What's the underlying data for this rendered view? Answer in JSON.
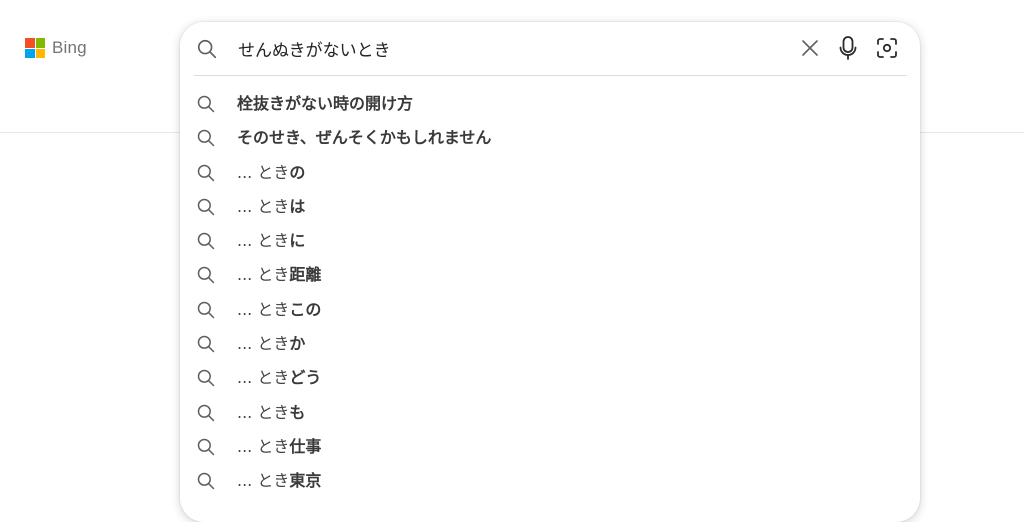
{
  "brand": {
    "name": "Bing",
    "logo_colors": [
      "#f25022",
      "#7fba00",
      "#00a4ef",
      "#ffb900"
    ]
  },
  "search": {
    "query": "せんぬきがないとき",
    "icons": {
      "search": "search-icon",
      "clear": "close-icon",
      "voice": "microphone-icon",
      "visual": "visual-search-icon"
    }
  },
  "suggestions": [
    {
      "prefix": "",
      "completion": "栓抜きがない時の開け方"
    },
    {
      "prefix": "",
      "completion": "そのせき、ぜんそくかもしれません"
    },
    {
      "prefix": "... とき",
      "completion": "の"
    },
    {
      "prefix": "... とき",
      "completion": "は"
    },
    {
      "prefix": "... とき",
      "completion": "に"
    },
    {
      "prefix": "... とき",
      "completion": "距離"
    },
    {
      "prefix": "... とき",
      "completion": "この"
    },
    {
      "prefix": "... とき",
      "completion": "か"
    },
    {
      "prefix": "... とき",
      "completion": "どう"
    },
    {
      "prefix": "... とき",
      "completion": "も"
    },
    {
      "prefix": "... とき",
      "completion": "仕事"
    },
    {
      "prefix": "... とき",
      "completion": "東京"
    }
  ],
  "colors": {
    "text": "#444444",
    "icon": "#5f5f5f",
    "divider": "#dcdcdc"
  }
}
